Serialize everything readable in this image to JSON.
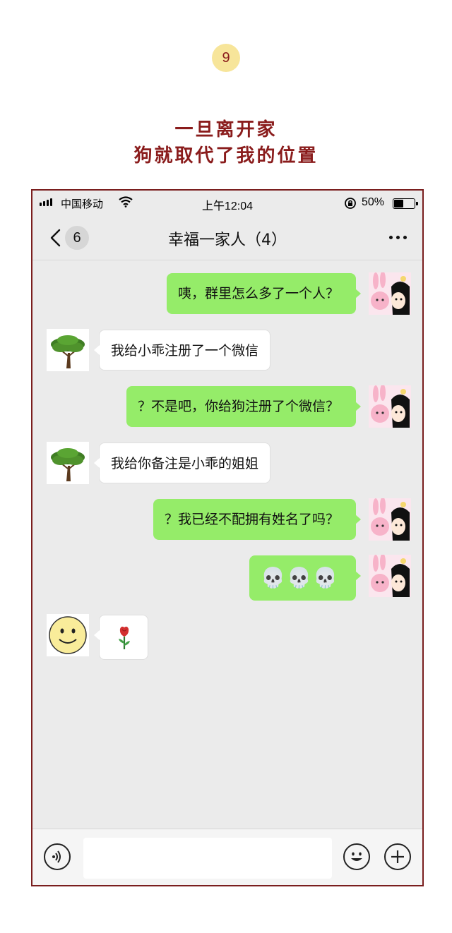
{
  "page": {
    "number": "9",
    "heading_line1": "一旦离开家",
    "heading_line2": "狗就取代了我的位置"
  },
  "status_bar": {
    "carrier": "中国移动",
    "time": "上午12:04",
    "battery": "50%",
    "battery_level": 0.5
  },
  "nav": {
    "unread_count": "6",
    "title": "幸福一家人（4）"
  },
  "messages": [
    {
      "from": "me",
      "avatar": "girl-avatar",
      "text": "咦，群里怎么多了一个人？"
    },
    {
      "from": "other",
      "avatar": "tree-avatar",
      "text": "我给小乖注册了一个微信"
    },
    {
      "from": "me",
      "avatar": "girl-avatar",
      "text": "？不是吧，你给狗注册了个微信？"
    },
    {
      "from": "other",
      "avatar": "tree-avatar",
      "text": "我给你备注是小乖的姐姐"
    },
    {
      "from": "me",
      "avatar": "girl-avatar",
      "text": "？我已经不配拥有姓名了吗？"
    },
    {
      "from": "me",
      "avatar": "girl-avatar",
      "text": "💀💀💀"
    },
    {
      "from": "other",
      "avatar": "smiley-avatar",
      "text": "🌹"
    }
  ],
  "input_bar": {
    "placeholder": "",
    "icons": [
      "voice-icon",
      "emoji-icon",
      "plus-icon"
    ]
  },
  "colors": {
    "accent": "#8a1c1c",
    "badge": "#f7e59a",
    "my_bubble": "#95ec69",
    "chat_bg": "#ebebeb"
  }
}
